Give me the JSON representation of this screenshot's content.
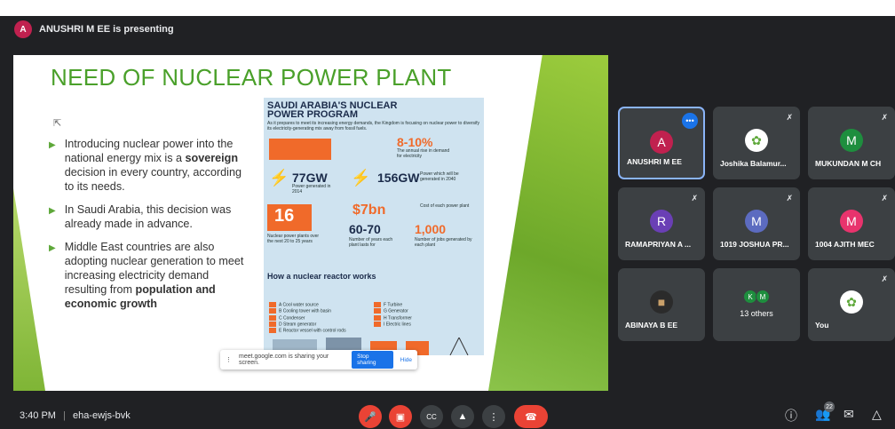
{
  "presenter": {
    "initial": "A",
    "text": "ANUSHRI M EE is presenting"
  },
  "slide": {
    "title": "NEED OF NUCLEAR POWER PLANT",
    "bullets": [
      {
        "pre": "Introducing nuclear power into the national energy mix is a ",
        "bold": "sovereign",
        "post": " decision in every country, according to its needs."
      },
      {
        "pre": "In Saudi Arabia, this decision was already made in advance.",
        "bold": "",
        "post": ""
      },
      {
        "pre": "Middle East countries are also adopting nuclear generation to meet increasing electricity demand resulting from ",
        "bold": "population and economic growth",
        "post": ""
      }
    ],
    "infographic": {
      "title": "SAUDI ARABIA'S NUCLEAR POWER PROGRAM",
      "subtitle": "As it prepares to meet its increasing energy demands, the Kingdom is focusing on nuclear power to diversify its electricity-generating mix away from fossil fuels.",
      "stat_rise": "8-10%",
      "stat_rise_cap": "The annual rise in demand for electricity",
      "stat_77": "77GW",
      "stat_77_cap": "Power generated in 2014",
      "stat_156": "156GW",
      "stat_156_cap": "Power which will be generated in 2040",
      "stat_16": "16",
      "stat_16_cap": "Nuclear power plants over the next 20 to 25 years",
      "stat_7bn": "$7bn",
      "stat_7bn_cap": "Cost of each power plant",
      "stat_6070": "60-70",
      "stat_6070_cap": "Number of years each plant lasts for",
      "stat_1000": "1,000",
      "stat_1000_cap": "Number of jobs generated by each plant",
      "how_title": "How a nuclear reactor works",
      "legend": [
        "A Cool water source",
        "F Turbine",
        "B Cooling tower with basin",
        "G Generator",
        "C Condenser",
        "H Transformer",
        "D Steam generator",
        "I Electric lines",
        "E Reactor vessel with control rods",
        ""
      ]
    }
  },
  "share_bar": {
    "text": "meet.google.com is sharing your screen.",
    "stop": "Stop sharing",
    "hide": "Hide"
  },
  "participants": [
    {
      "name": "ANUSHRI M EE",
      "initial": "A",
      "color": "#c0214f"
    },
    {
      "name": "Joshika Balamur...",
      "initial": "",
      "color": "#ffffff"
    },
    {
      "name": "MUKUNDAN M CH",
      "initial": "M",
      "color": "#1e8e3e"
    },
    {
      "name": "RAMAPRIYAN A ...",
      "initial": "R",
      "color": "#6a3fb5"
    },
    {
      "name": "1019 JOSHUA PR...",
      "initial": "M",
      "color": "#5c6bc0"
    },
    {
      "name": "1004 AJITH MEC",
      "initial": "M",
      "color": "#e8336d"
    },
    {
      "name": "ABINAYA B EE",
      "initial": "",
      "color": "#2b2b2b"
    },
    {
      "name": "13 others",
      "initial": "K M",
      "color": "#1e8e3e"
    },
    {
      "name": "You",
      "initial": "",
      "color": "#ffffff"
    }
  ],
  "others_initials": [
    "K",
    "M"
  ],
  "bottom": {
    "time": "3:40 PM",
    "separator": "|",
    "meeting_code": "eha-ewjs-bvk",
    "people_count": "22"
  }
}
